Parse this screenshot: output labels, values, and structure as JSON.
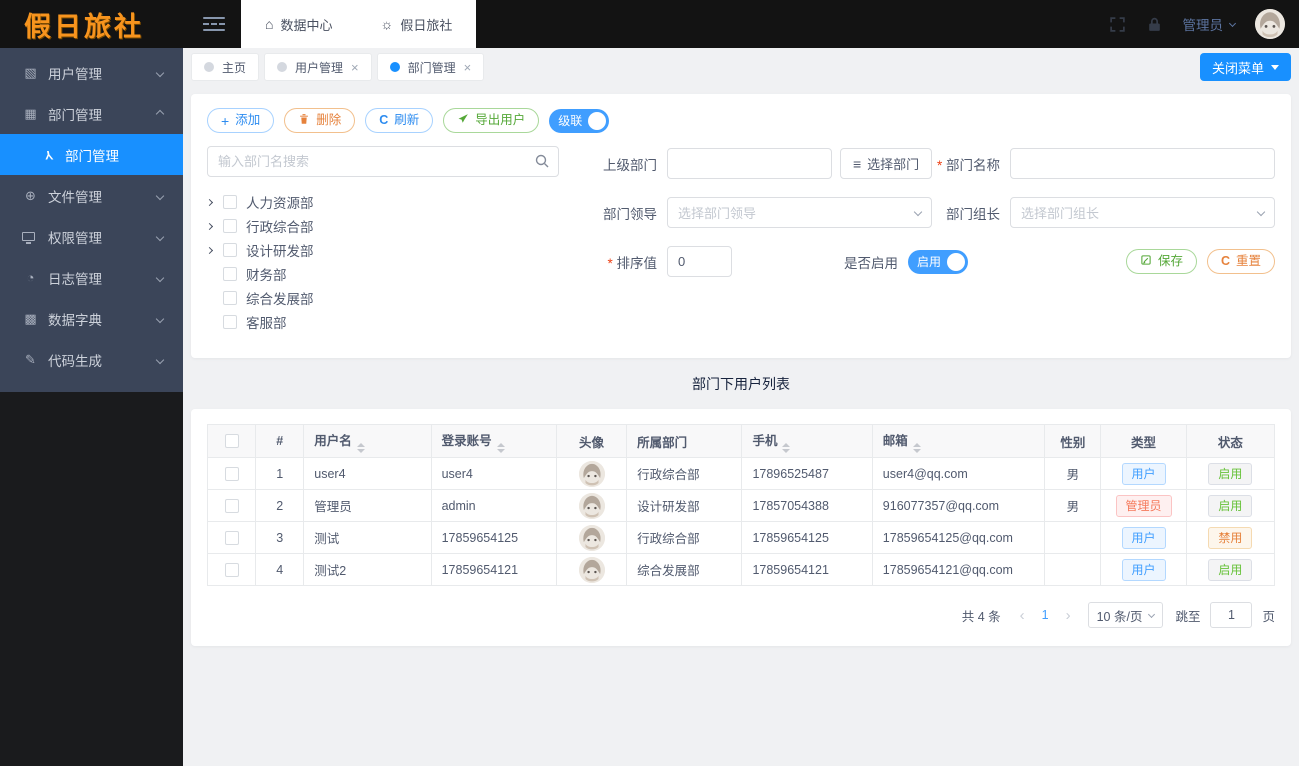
{
  "logo": "假日旅社",
  "topbar": {
    "nav": [
      {
        "name": "data-center",
        "icon": "home-icon",
        "label": "数据中心"
      },
      {
        "name": "holiday-inn",
        "icon": "bulb-icon",
        "label": "假日旅社"
      }
    ],
    "username": "管理员"
  },
  "sidebar": {
    "items": [
      {
        "name": "users",
        "icon": "image-icon",
        "label": "用户管理",
        "expanded": false
      },
      {
        "name": "departments",
        "icon": "grid-icon",
        "label": "部门管理",
        "expanded": true,
        "children": [
          {
            "name": "department-manage",
            "icon": "branch-icon",
            "label": "部门管理",
            "active": true
          }
        ]
      },
      {
        "name": "files",
        "icon": "globe-icon",
        "label": "文件管理",
        "expanded": false
      },
      {
        "name": "permissions",
        "icon": "monitor-icon",
        "label": "权限管理",
        "expanded": false
      },
      {
        "name": "logs",
        "icon": "clock-icon",
        "label": "日志管理",
        "expanded": false
      },
      {
        "name": "dictionary",
        "icon": "dict-grid-icon",
        "label": "数据字典",
        "expanded": false
      },
      {
        "name": "codegen",
        "icon": "pencil-icon",
        "label": "代码生成",
        "expanded": false
      }
    ]
  },
  "tabs": [
    {
      "label": "主页",
      "closable": false,
      "active": false
    },
    {
      "label": "用户管理",
      "closable": true,
      "active": false
    },
    {
      "label": "部门管理",
      "closable": true,
      "active": true
    }
  ],
  "close_menu_label": "关闭菜单",
  "toolbar": {
    "add": "添加",
    "delete": "删除",
    "refresh": "刷新",
    "export": "导出用户",
    "cascade": "级联"
  },
  "dept_panel": {
    "search_placeholder": "输入部门名搜索",
    "tree": [
      {
        "label": "人力资源部",
        "expandable": true
      },
      {
        "label": "行政综合部",
        "expandable": true
      },
      {
        "label": "设计研发部",
        "expandable": true
      },
      {
        "label": "财务部",
        "expandable": false
      },
      {
        "label": "综合发展部",
        "expandable": false
      },
      {
        "label": "客服部",
        "expandable": false
      }
    ]
  },
  "form": {
    "parent_dept_label": "上级部门",
    "select_dept_button": "选择部门",
    "dept_name_label": "部门名称",
    "dept_leader_label": "部门领导",
    "dept_leader_placeholder": "选择部门领导",
    "dept_head_label": "部门组长",
    "dept_head_placeholder": "选择部门组长",
    "sort_label": "排序值",
    "sort_value": "0",
    "enabled_label": "是否启用",
    "enabled_state": "启用",
    "save_label": "保存",
    "reset_label": "重置"
  },
  "table": {
    "title": "部门下用户列表",
    "columns": [
      {
        "label": "#",
        "sortable": false
      },
      {
        "label": "用户名",
        "sortable": true
      },
      {
        "label": "登录账号",
        "sortable": true
      },
      {
        "label": "头像",
        "sortable": false
      },
      {
        "label": "所属部门",
        "sortable": false
      },
      {
        "label": "手机",
        "sortable": true
      },
      {
        "label": "邮箱",
        "sortable": true
      },
      {
        "label": "性别",
        "sortable": false
      },
      {
        "label": "类型",
        "sortable": false
      },
      {
        "label": "状态",
        "sortable": false
      }
    ],
    "rows": [
      {
        "index": "1",
        "username": "user4",
        "account": "user4",
        "dept": "行政综合部",
        "phone": "17896525487",
        "email": "user4@qq.com",
        "gender": "男",
        "type": "用户",
        "type_kind": "user",
        "status": "启用",
        "status_kind": "enabled"
      },
      {
        "index": "2",
        "username": "管理员",
        "account": "admin",
        "dept": "设计研发部",
        "phone": "17857054388",
        "email": "916077357@qq.com",
        "gender": "男",
        "type": "管理员",
        "type_kind": "admin",
        "status": "启用",
        "status_kind": "enabled"
      },
      {
        "index": "3",
        "username": "测试",
        "account": "17859654125",
        "dept": "行政综合部",
        "phone": "17859654125",
        "email": "17859654125@qq.com",
        "gender": "",
        "type": "用户",
        "type_kind": "user",
        "status": "禁用",
        "status_kind": "disabled"
      },
      {
        "index": "4",
        "username": "测试2",
        "account": "17859654121",
        "dept": "综合发展部",
        "phone": "17859654121",
        "email": "17859654121@qq.com",
        "gender": "",
        "type": "用户",
        "type_kind": "user",
        "status": "启用",
        "status_kind": "enabled"
      }
    ]
  },
  "pagination": {
    "total": "共 4 条",
    "current_page": "1",
    "page_size": "10 条/页",
    "jump_label": "跳至",
    "jump_value": "1",
    "unit": "页"
  }
}
